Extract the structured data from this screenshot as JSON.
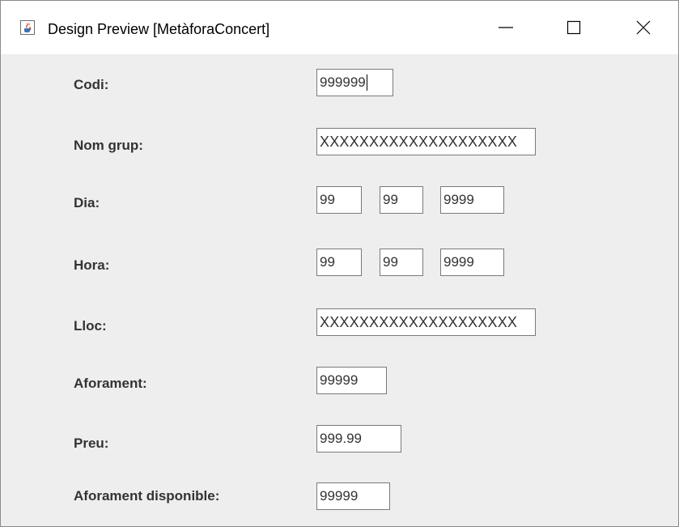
{
  "window": {
    "title": "Design Preview [MetàforaConcert]",
    "icon": "java-icon",
    "controls": [
      "minimize-icon",
      "maximize-icon",
      "close-icon"
    ]
  },
  "form": {
    "codi": {
      "label": "Codi:",
      "value": "999999"
    },
    "nom_grup": {
      "label": "Nom grup:",
      "value": "XXXXXXXXXXXXXXXXXXXX"
    },
    "dia": {
      "label": "Dia:",
      "day": "99",
      "month": "99",
      "year": "9999"
    },
    "hora": {
      "label": "Hora:",
      "h1": "99",
      "h2": "99",
      "h3": "9999"
    },
    "lloc": {
      "label": "Lloc:",
      "value": "XXXXXXXXXXXXXXXXXXXX"
    },
    "aforament": {
      "label": "Aforament:",
      "value": "99999"
    },
    "preu": {
      "label": "Preu:",
      "value": "999.99"
    },
    "aforament_disponible": {
      "label": "Aforament disponible:",
      "value": "99999"
    }
  }
}
